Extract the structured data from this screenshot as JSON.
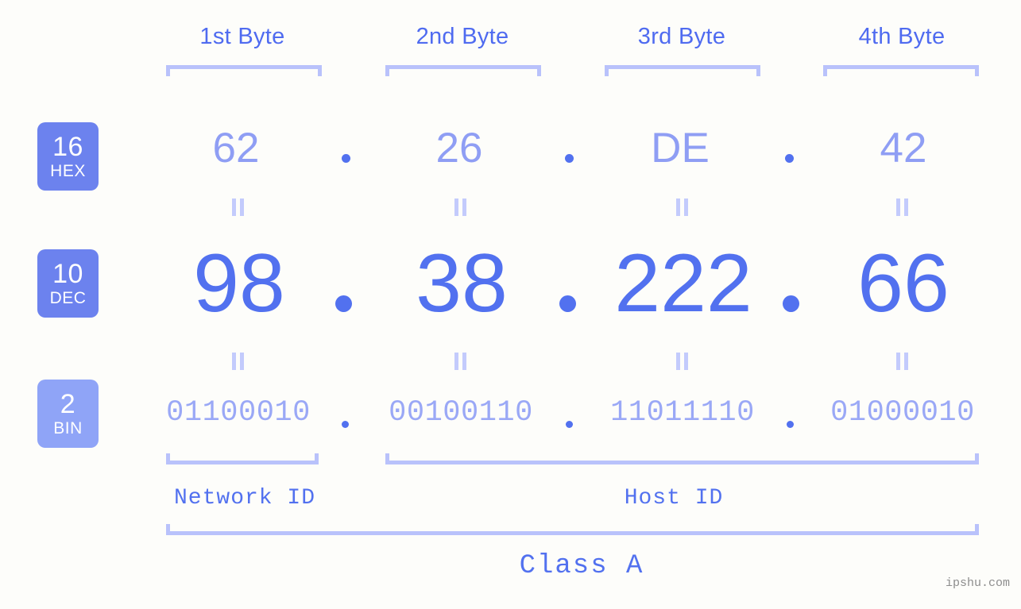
{
  "meta": {
    "watermark": "ipshu.com",
    "background_color": "#fdfdfa",
    "accent_color": "#5271ef",
    "badge_color_strong": "#6c82ee",
    "badge_color_light": "#8fa4f7",
    "bracket_color": "#b9c2fb"
  },
  "headers": {
    "byte1": "1st Byte",
    "byte2": "2nd Byte",
    "byte3": "3rd Byte",
    "byte4": "4th Byte"
  },
  "bases": {
    "hex": {
      "number": "16",
      "label": "HEX"
    },
    "dec": {
      "number": "10",
      "label": "DEC"
    },
    "bin": {
      "number": "2",
      "label": "BIN"
    }
  },
  "rows": {
    "hex": {
      "values": [
        "62",
        "26",
        "DE",
        "42"
      ],
      "separator": "."
    },
    "dec": {
      "values": [
        "98",
        "38",
        "222",
        "66"
      ],
      "separator": "."
    },
    "bin": {
      "values": [
        "01100010",
        "00100110",
        "11011110",
        "01000010"
      ],
      "separator": "."
    }
  },
  "equals_symbol": "=",
  "sections": {
    "network_id": "Network ID",
    "host_id": "Host ID",
    "class": "Class A"
  }
}
